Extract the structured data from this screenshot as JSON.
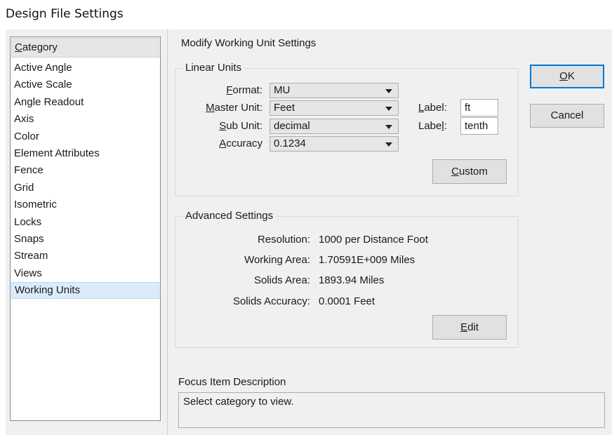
{
  "window": {
    "title": "Design File Settings"
  },
  "category": {
    "header_prefix": "",
    "header_mnemonic": "C",
    "header_rest": "ategory",
    "items": [
      "Active Angle",
      "Active Scale",
      "Angle Readout",
      "Axis",
      "Color",
      "Element Attributes",
      "Fence",
      "Grid",
      "Isometric",
      "Locks",
      "Snaps",
      "Stream",
      "Views",
      "Working Units"
    ],
    "selected": "Working Units"
  },
  "main": {
    "section_title": "Modify Working Unit Settings"
  },
  "linear_units": {
    "group_label": "Linear Units",
    "format": {
      "label_pre": "",
      "mnemonic": "F",
      "label_post": "ormat:",
      "value": "MU"
    },
    "master_unit": {
      "label_pre": "",
      "mnemonic": "M",
      "label_post": "aster Unit:",
      "value": "Feet"
    },
    "sub_unit": {
      "label_pre": "",
      "mnemonic": "S",
      "label_post": "ub Unit:",
      "value": "decimal"
    },
    "accuracy": {
      "label_pre": "",
      "mnemonic": "A",
      "label_post": "ccuracy",
      "value": "0.1234"
    },
    "master_label": {
      "label_pre": "",
      "mnemonic": "L",
      "label_post": "abel:",
      "value": "ft"
    },
    "sub_label": {
      "label_pre": "Labe",
      "mnemonic": "l",
      "label_post": ":",
      "value": "tenth"
    },
    "custom_button": {
      "pre": "",
      "mnemonic": "C",
      "post": "ustom"
    }
  },
  "advanced": {
    "group_label": "Advanced Settings",
    "rows": [
      {
        "label": "Resolution:",
        "value": "1000 per Distance Foot"
      },
      {
        "label": "Working Area:",
        "value": "1.70591E+009 Miles"
      },
      {
        "label": "Solids Area:",
        "value": "1893.94 Miles"
      },
      {
        "label": "Solids Accuracy:",
        "value": "0.0001 Feet"
      }
    ],
    "edit_button": {
      "pre": "",
      "mnemonic": "E",
      "post": "dit"
    }
  },
  "buttons": {
    "ok": {
      "pre": "",
      "mnemonic": "O",
      "post": "K"
    },
    "cancel": "Cancel"
  },
  "focus": {
    "label": "Focus Item Description",
    "text": "Select category to view."
  },
  "colors": {
    "dialog_bg": "#f0f0f0",
    "selection_bg": "#dcebfa",
    "default_button_border": "#0078d7"
  },
  "icons": {
    "combo_arrow": "chevron-down-icon"
  }
}
